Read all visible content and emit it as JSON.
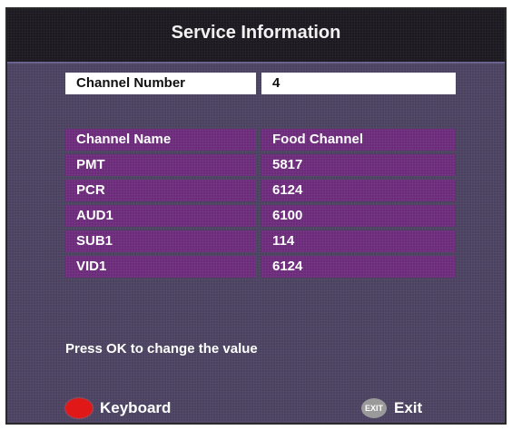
{
  "title": "Service Information",
  "channel_number": {
    "label": "Channel Number",
    "value": "4"
  },
  "table": [
    {
      "label": "Channel Name",
      "value": "Food Channel"
    },
    {
      "label": "PMT",
      "value": "5817"
    },
    {
      "label": "PCR",
      "value": "6124"
    },
    {
      "label": "AUD1",
      "value": "6100"
    },
    {
      "label": "SUB1",
      "value": "114"
    },
    {
      "label": "VID1",
      "value": "6124"
    }
  ],
  "hint": "Press OK to change the value",
  "keys": {
    "keyboard_label": "Keyboard",
    "exit_badge": "EXIT",
    "exit_label": "Exit"
  },
  "colors": {
    "background": "#4a4260",
    "row_purple": "#6b2a7a",
    "red_button": "#e01818"
  }
}
